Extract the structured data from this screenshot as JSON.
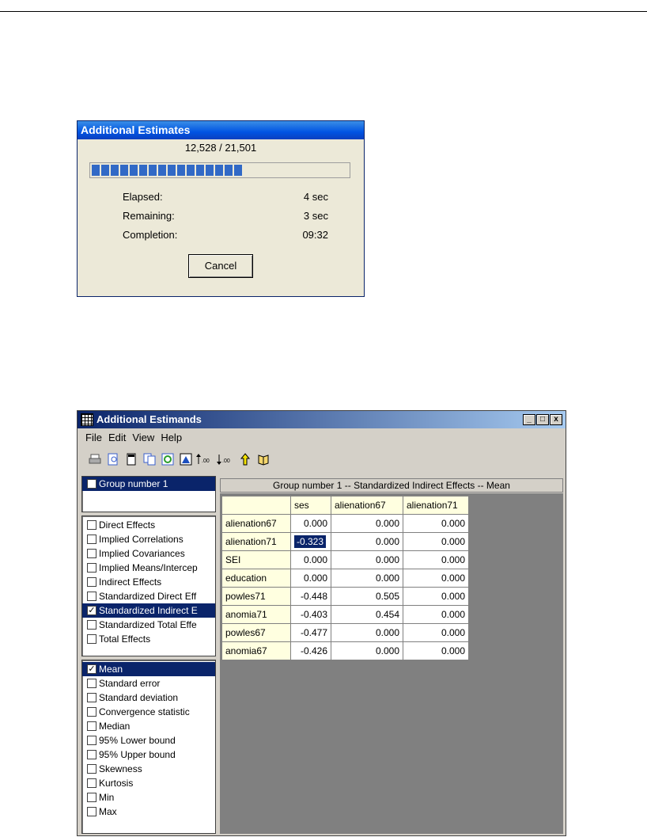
{
  "progress_dialog": {
    "title": "Additional Estimates",
    "count": "12,528 / 21,501",
    "progress_fraction": 0.583,
    "elapsed_label": "Elapsed:",
    "elapsed_value": "4 sec",
    "remaining_label": "Remaining:",
    "remaining_value": "3 sec",
    "completion_label": "Completion:",
    "completion_value": "09:32",
    "cancel_label": "Cancel"
  },
  "window": {
    "title": "Additional Estimands",
    "minimize": "_",
    "maximize": "□",
    "close": "x",
    "menu": [
      "File",
      "Edit",
      "View",
      "Help"
    ],
    "toolbar_icons": [
      "print-icon",
      "preview-icon",
      "document-icon",
      "copy-icon",
      "refresh-icon",
      "chart-icon",
      "decimals-increase-icon",
      "decimals-decrease-icon",
      "up-arrow-icon",
      "book-icon"
    ],
    "groups": [
      {
        "label": "Group number 1",
        "checked": false,
        "selected": true
      }
    ],
    "estimands": [
      {
        "label": "Direct Effects",
        "checked": false,
        "selected": false
      },
      {
        "label": "Implied Correlations",
        "checked": false,
        "selected": false
      },
      {
        "label": "Implied Covariances",
        "checked": false,
        "selected": false
      },
      {
        "label": "Implied Means/Intercep",
        "checked": false,
        "selected": false
      },
      {
        "label": "Indirect Effects",
        "checked": false,
        "selected": false
      },
      {
        "label": "Standardized Direct Eff",
        "checked": false,
        "selected": false
      },
      {
        "label": "Standardized Indirect E",
        "checked": true,
        "selected": true
      },
      {
        "label": "Standardized Total Effe",
        "checked": false,
        "selected": false
      },
      {
        "label": "Total Effects",
        "checked": false,
        "selected": false
      }
    ],
    "statistics": [
      {
        "label": "Mean",
        "checked": true,
        "selected": true
      },
      {
        "label": "Standard error",
        "checked": false,
        "selected": false
      },
      {
        "label": "Standard deviation",
        "checked": false,
        "selected": false
      },
      {
        "label": "Convergence statistic",
        "checked": false,
        "selected": false
      },
      {
        "label": "Median",
        "checked": false,
        "selected": false
      },
      {
        "label": "95% Lower bound",
        "checked": false,
        "selected": false
      },
      {
        "label": "95% Upper bound",
        "checked": false,
        "selected": false
      },
      {
        "label": "Skewness",
        "checked": false,
        "selected": false
      },
      {
        "label": "Kurtosis",
        "checked": false,
        "selected": false
      },
      {
        "label": "Min",
        "checked": false,
        "selected": false
      },
      {
        "label": "Max",
        "checked": false,
        "selected": false
      }
    ],
    "grid_title": "Group number 1 -- Standardized Indirect Effects -- Mean",
    "columns": [
      "ses",
      "alienation67",
      "alienation71"
    ],
    "rows": [
      {
        "label": "alienation67",
        "values": [
          "0.000",
          "0.000",
          "0.000"
        ]
      },
      {
        "label": "alienation71",
        "values": [
          "-0.323",
          "0.000",
          "0.000"
        ]
      },
      {
        "label": "SEI",
        "values": [
          "0.000",
          "0.000",
          "0.000"
        ]
      },
      {
        "label": "education",
        "values": [
          "0.000",
          "0.000",
          "0.000"
        ]
      },
      {
        "label": "powles71",
        "values": [
          "-0.448",
          "0.505",
          "0.000"
        ]
      },
      {
        "label": "anomia71",
        "values": [
          "-0.403",
          "0.454",
          "0.000"
        ]
      },
      {
        "label": "powles67",
        "values": [
          "-0.477",
          "0.000",
          "0.000"
        ]
      },
      {
        "label": "anomia67",
        "values": [
          "-0.426",
          "0.000",
          "0.000"
        ]
      }
    ],
    "highlighted_cell": {
      "row": 1,
      "col": 0
    }
  }
}
